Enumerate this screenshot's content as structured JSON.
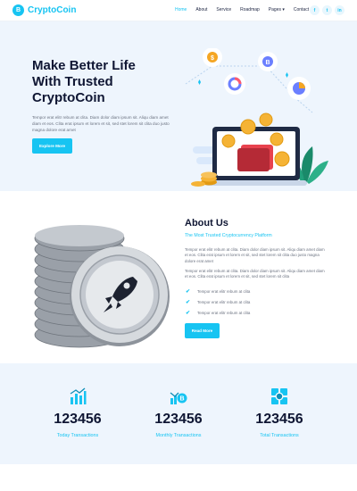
{
  "brand": {
    "logo_glyph": "B",
    "name": "CryptoCoin",
    "accent": "#17c4f2"
  },
  "nav": {
    "items": [
      {
        "label": "Home",
        "active": true
      },
      {
        "label": "About",
        "active": false
      },
      {
        "label": "Service",
        "active": false
      },
      {
        "label": "Roadmap",
        "active": false
      },
      {
        "label": "Pages ▾",
        "active": false
      },
      {
        "label": "Contact",
        "active": false
      }
    ],
    "social": [
      {
        "icon": "facebook-icon",
        "glyph": "f"
      },
      {
        "icon": "twitter-icon",
        "glyph": "t"
      },
      {
        "icon": "linkedin-icon",
        "glyph": "in"
      }
    ]
  },
  "hero": {
    "title": "Make Better Life With Trusted CryptoCoin",
    "text": "Tempor erat elitr rebum at clita. Diam dolor diam ipsum sit. Aliqu diam amet diam et eos. Clita erat ipsum et lorem et sit, sed stet lorem sit clita duo justo magna dolore erat amet",
    "button": "Explore More",
    "illustration_icons": [
      "dollar-coin-icon",
      "bitcoin-coin-icon",
      "donut-chart-icon",
      "pie-chart-icon",
      "laptop-icon",
      "wallet-icon"
    ]
  },
  "about": {
    "title": "About Us",
    "subtitle": "The Most Trusted Cryptocurrency Platform",
    "p1": "Tempor erat elitr rebum at clita. Diam dolor diam ipsum sit. Aliqu diam amet diam et eos. Clita erat ipsum et lorem et sit, sed stet lorem sit clita duo justo magna dolore erat amet",
    "p2": "Tempor erat elitr rebum at clita. Diam dolor diam ipsum sit. Aliqu diam amet diam et eos. Clita erat ipsum et lorem et sit, sed stet lorem sit clita",
    "checks": [
      "Tempor erat elitr rebum at clita",
      "Tempor erat elitr rebum at clita",
      "Tempor erat elitr rebum at clita"
    ],
    "button": "Read More"
  },
  "stats": [
    {
      "icon": "bar-chart-icon",
      "value": "123456",
      "label": "Today Transactions"
    },
    {
      "icon": "bitcoin-chart-icon",
      "value": "123456",
      "label": "Monthly Transactions"
    },
    {
      "icon": "crypto-grid-icon",
      "value": "123456",
      "label": "Total Transactions"
    }
  ]
}
